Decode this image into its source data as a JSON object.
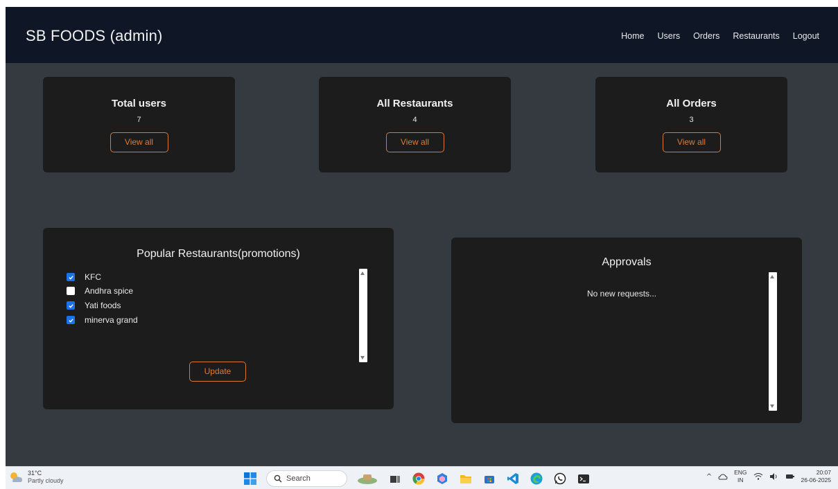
{
  "navbar": {
    "brand": "SB FOODS (admin)",
    "links": [
      "Home",
      "Users",
      "Orders",
      "Restaurants",
      "Logout"
    ]
  },
  "stats": [
    {
      "title": "Total users",
      "count": "7",
      "button": "View all"
    },
    {
      "title": "All Restaurants",
      "count": "4",
      "button": "View all"
    },
    {
      "title": "All Orders",
      "count": "3",
      "button": "View all"
    }
  ],
  "promotions": {
    "title": "Popular Restaurants(promotions)",
    "restaurants": [
      {
        "name": "KFC",
        "checked": true
      },
      {
        "name": "Andhra spice",
        "checked": false
      },
      {
        "name": "Yati foods",
        "checked": true
      },
      {
        "name": "minerva grand",
        "checked": true
      }
    ],
    "button": "Update"
  },
  "approvals": {
    "title": "Approvals",
    "empty_text": "No new requests..."
  },
  "taskbar": {
    "weather_temp": "31°C",
    "weather_condition": "Partly cloudy",
    "search_placeholder": "Search",
    "lang_top": "ENG",
    "lang_bottom": "IN",
    "time": "20:07",
    "date": "26-06-2025"
  },
  "colors": {
    "navbar_bg": "#0f1726",
    "page_bg": "#343a40",
    "card_bg": "#1c1c1c",
    "accent": "#e07b35",
    "checkbox": "#1a73e8"
  }
}
